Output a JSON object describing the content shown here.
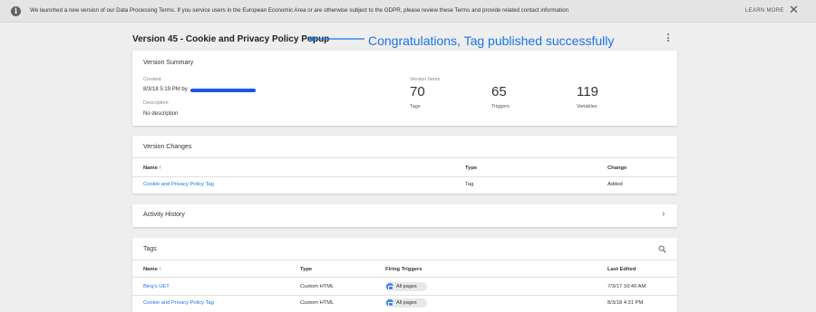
{
  "banner": {
    "message": "We launched a new version of our Data Processing Terms. If you service users in the European Economic Area or are otherwise subject to the GDPR, please review these Terms and provide related contact information",
    "learn_more": "LEARN MORE",
    "info_icon": "i",
    "close_icon": "✕"
  },
  "header": {
    "title": "Version 45 - Cookie and Privacy Policy Popup",
    "announcement": "Congratulations, Tag published successfully"
  },
  "summary": {
    "title": "Version Summary",
    "created_label": "Created",
    "created_value": "8/3/18 5:19 PM by",
    "description_label": "Description",
    "description_value": "No description",
    "items_label": "Version Items",
    "counts": [
      {
        "value": "70",
        "label": "Tags"
      },
      {
        "value": "65",
        "label": "Triggers"
      },
      {
        "value": "119",
        "label": "Variables"
      }
    ]
  },
  "changes": {
    "title": "Version Changes",
    "headers": {
      "name": "Name ↑",
      "type": "Type",
      "change": "Change"
    },
    "rows": [
      {
        "name": "Cookie and Privacy Policy Tag",
        "type": "Tag",
        "change": "Added"
      }
    ]
  },
  "activity": {
    "title": "Activity History",
    "chevron": "›"
  },
  "tags": {
    "title": "Tags",
    "headers": {
      "name": "Name ↑",
      "type": "Type",
      "triggers": "Firing Triggers",
      "edited": "Last Edited"
    },
    "rows": [
      {
        "name": "Bing's UET",
        "type": "Custom HTML",
        "trigger": "All pages",
        "edited": "7/3/17 10:40 AM"
      },
      {
        "name": "Cookie and Privacy Policy Tag",
        "type": "Custom HTML",
        "trigger": "All pages",
        "edited": "8/3/18 4:31 PM"
      }
    ]
  },
  "colors": {
    "accent": "#1a73e8",
    "background": "#eeeeee",
    "card": "#ffffff"
  }
}
